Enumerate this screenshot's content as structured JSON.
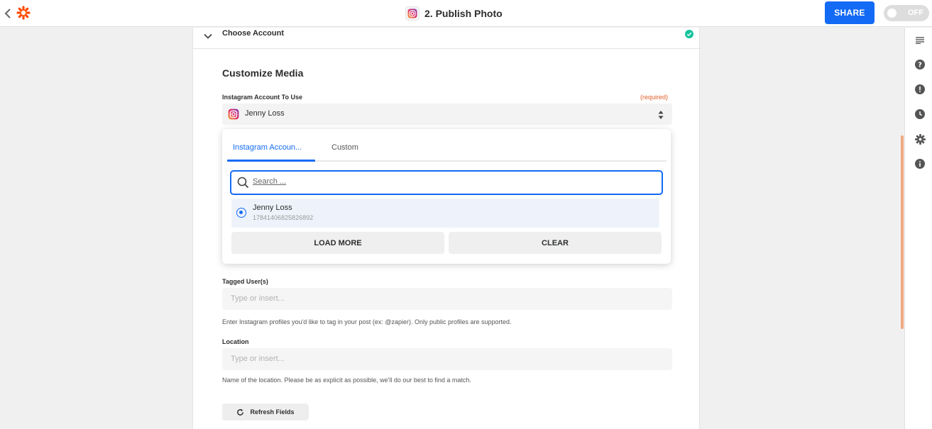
{
  "topbar": {
    "title": "2. Publish Photo",
    "share_label": "SHARE",
    "toggle_label": "OFF",
    "brand_color": "#ff4a00"
  },
  "step": {
    "label": "Choose Account"
  },
  "form": {
    "heading": "Customize Media",
    "account_label": "Instagram Account To Use",
    "required_label": "(required)",
    "account_value": "Jenny Loss",
    "tagged_label": "Tagged User(s)",
    "tagged_placeholder": "Type or insert...",
    "tagged_help": "Enter Instagram profiles you'd like to tag in your post (ex: @zapier). Only public profiles are supported.",
    "location_label": "Location",
    "location_placeholder": "Type or insert...",
    "location_help": "Name of the location. Please be as explicit as possible, we'll do our best to find a match.",
    "refresh_label": "Refresh Fields"
  },
  "dropdown": {
    "tabs": [
      "Instagram Accoun...",
      "Custom"
    ],
    "search_placeholder": "Search ...",
    "option": {
      "name": "Jenny Loss",
      "id": "17841406825826892"
    },
    "load_more_label": "LOAD MORE",
    "clear_label": "CLEAR"
  },
  "colors": {
    "accent": "#136bf5",
    "required": "#e05d26",
    "success": "#13c39c"
  },
  "rightbar": {
    "icons": [
      "details-icon",
      "help-icon",
      "alert-icon",
      "history-icon",
      "settings-icon",
      "info-icon"
    ]
  }
}
